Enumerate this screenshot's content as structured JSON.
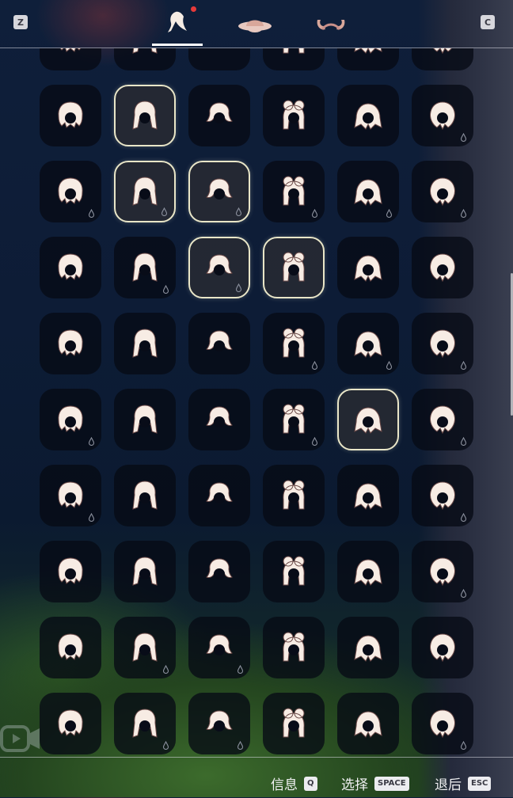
{
  "topbar": {
    "left_key": "Z",
    "right_key": "C",
    "tabs": [
      {
        "icon": "hair-icon",
        "active": true,
        "notification": true
      },
      {
        "icon": "hat-icon",
        "active": false,
        "notification": false
      },
      {
        "icon": "horns-icon",
        "active": false,
        "notification": false
      }
    ]
  },
  "grid": {
    "cells": [
      {
        "icon": "partial-hair-icon",
        "selected": false,
        "drop": false
      },
      {
        "icon": "partial-hair-icon",
        "selected": false,
        "drop": false
      },
      {
        "icon": "partial-hair-icon",
        "selected": false,
        "drop": false
      },
      {
        "icon": "partial-hair-icon",
        "selected": false,
        "drop": false
      },
      {
        "icon": "partial-hair-icon",
        "selected": false,
        "drop": false
      },
      {
        "icon": "partial-hair-icon",
        "selected": false,
        "drop": false
      },
      {
        "icon": "short-bob-hair-icon",
        "selected": false,
        "drop": false
      },
      {
        "icon": "ponytail-hair-icon",
        "selected": true,
        "drop": false
      },
      {
        "icon": "pigtails-hair-icon",
        "selected": false,
        "drop": false
      },
      {
        "icon": "double-bun-hair-icon",
        "selected": false,
        "drop": false
      },
      {
        "icon": "swept-hair-icon",
        "selected": false,
        "drop": false
      },
      {
        "icon": "curly-hair-icon",
        "selected": false,
        "drop": true
      },
      {
        "icon": "straw-hat-icon",
        "selected": false,
        "drop": true
      },
      {
        "icon": "bun-braids-hair-icon",
        "selected": true,
        "drop": true
      },
      {
        "icon": "wide-hat-icon",
        "selected": true,
        "drop": true
      },
      {
        "icon": "cap-hat-icon",
        "selected": false,
        "drop": true
      },
      {
        "icon": "flower-crown-hair-icon",
        "selected": false,
        "drop": true
      },
      {
        "icon": "updo-hair-icon",
        "selected": false,
        "drop": true
      },
      {
        "icon": "messy-short-hair-icon",
        "selected": false,
        "drop": false
      },
      {
        "icon": "long-braids-hair-icon",
        "selected": false,
        "drop": true
      },
      {
        "icon": "pink-hood-icon",
        "selected": true,
        "drop": true
      },
      {
        "icon": "spiky-hair-icon",
        "selected": true,
        "drop": false
      },
      {
        "icon": "long-wavy-hair-icon",
        "selected": false,
        "drop": false
      },
      {
        "icon": "sailor-cap-icon",
        "selected": false,
        "drop": false
      },
      {
        "icon": "feather-headdress-icon",
        "selected": false,
        "drop": false
      },
      {
        "icon": "pointed-hood-icon",
        "selected": false,
        "drop": false
      },
      {
        "icon": "tousled-hair-icon",
        "selected": false,
        "drop": false
      },
      {
        "icon": "topknot-hair-icon",
        "selected": false,
        "drop": true
      },
      {
        "icon": "side-bun-hair-icon",
        "selected": false,
        "drop": true
      },
      {
        "icon": "curly-long-hair-icon",
        "selected": false,
        "drop": true
      },
      {
        "icon": "wild-hair-icon",
        "selected": false,
        "drop": true
      },
      {
        "icon": "single-braid-hair-icon",
        "selected": false,
        "drop": false
      },
      {
        "icon": "side-braid-hair-icon",
        "selected": false,
        "drop": false
      },
      {
        "icon": "bonnet-hair-icon",
        "selected": false,
        "drop": true
      },
      {
        "icon": "winged-helmet-icon",
        "selected": true,
        "drop": false
      },
      {
        "icon": "hood-ring-icon",
        "selected": false,
        "drop": true
      },
      {
        "icon": "cat-ear-hood-icon",
        "selected": false,
        "drop": true
      },
      {
        "icon": "long-straight-hair-icon",
        "selected": false,
        "drop": false
      },
      {
        "icon": "big-curly-hair-icon",
        "selected": false,
        "drop": false
      },
      {
        "icon": "bangs-long-hair-icon",
        "selected": false,
        "drop": false
      },
      {
        "icon": "braided-long-hair-icon",
        "selected": false,
        "drop": false
      },
      {
        "icon": "crown-hair-icon",
        "selected": false,
        "drop": true
      },
      {
        "icon": "flame-hair-icon",
        "selected": false,
        "drop": false
      },
      {
        "icon": "tassel-hair-icon",
        "selected": false,
        "drop": false
      },
      {
        "icon": "earring-hair-icon",
        "selected": false,
        "drop": false
      },
      {
        "icon": "dreadlocks-hair-icon",
        "selected": false,
        "drop": false
      },
      {
        "icon": "bob-hair-icon",
        "selected": false,
        "drop": false
      },
      {
        "icon": "beanie-hair-icon",
        "selected": false,
        "drop": true
      },
      {
        "icon": "shaggy-hair-icon",
        "selected": false,
        "drop": false
      },
      {
        "icon": "bandana-hair-icon",
        "selected": false,
        "drop": true
      },
      {
        "icon": "spiky-headband-icon",
        "selected": false,
        "drop": true
      },
      {
        "icon": "swoop-hair-icon",
        "selected": false,
        "drop": false
      },
      {
        "icon": "side-ponytail-hair-icon",
        "selected": false,
        "drop": false
      },
      {
        "icon": "pompadour-hair-icon",
        "selected": false,
        "drop": false
      },
      {
        "icon": "cat-ear-hair-icon",
        "selected": false,
        "drop": false
      },
      {
        "icon": "medallion-icon",
        "selected": false,
        "drop": true
      },
      {
        "icon": "mask-hair-icon",
        "selected": false,
        "drop": true
      },
      {
        "icon": "pageboy-hair-icon",
        "selected": false,
        "drop": false
      },
      {
        "icon": "beaded-braids-hair-icon",
        "selected": false,
        "drop": false
      },
      {
        "icon": "long-flowing-hair-icon",
        "selected": false,
        "drop": true
      }
    ]
  },
  "bottombar": {
    "hints": [
      {
        "label": "信息",
        "key": "Q"
      },
      {
        "label": "选择",
        "key": "SPACE"
      },
      {
        "label": "退后",
        "key": "ESC"
      }
    ]
  }
}
